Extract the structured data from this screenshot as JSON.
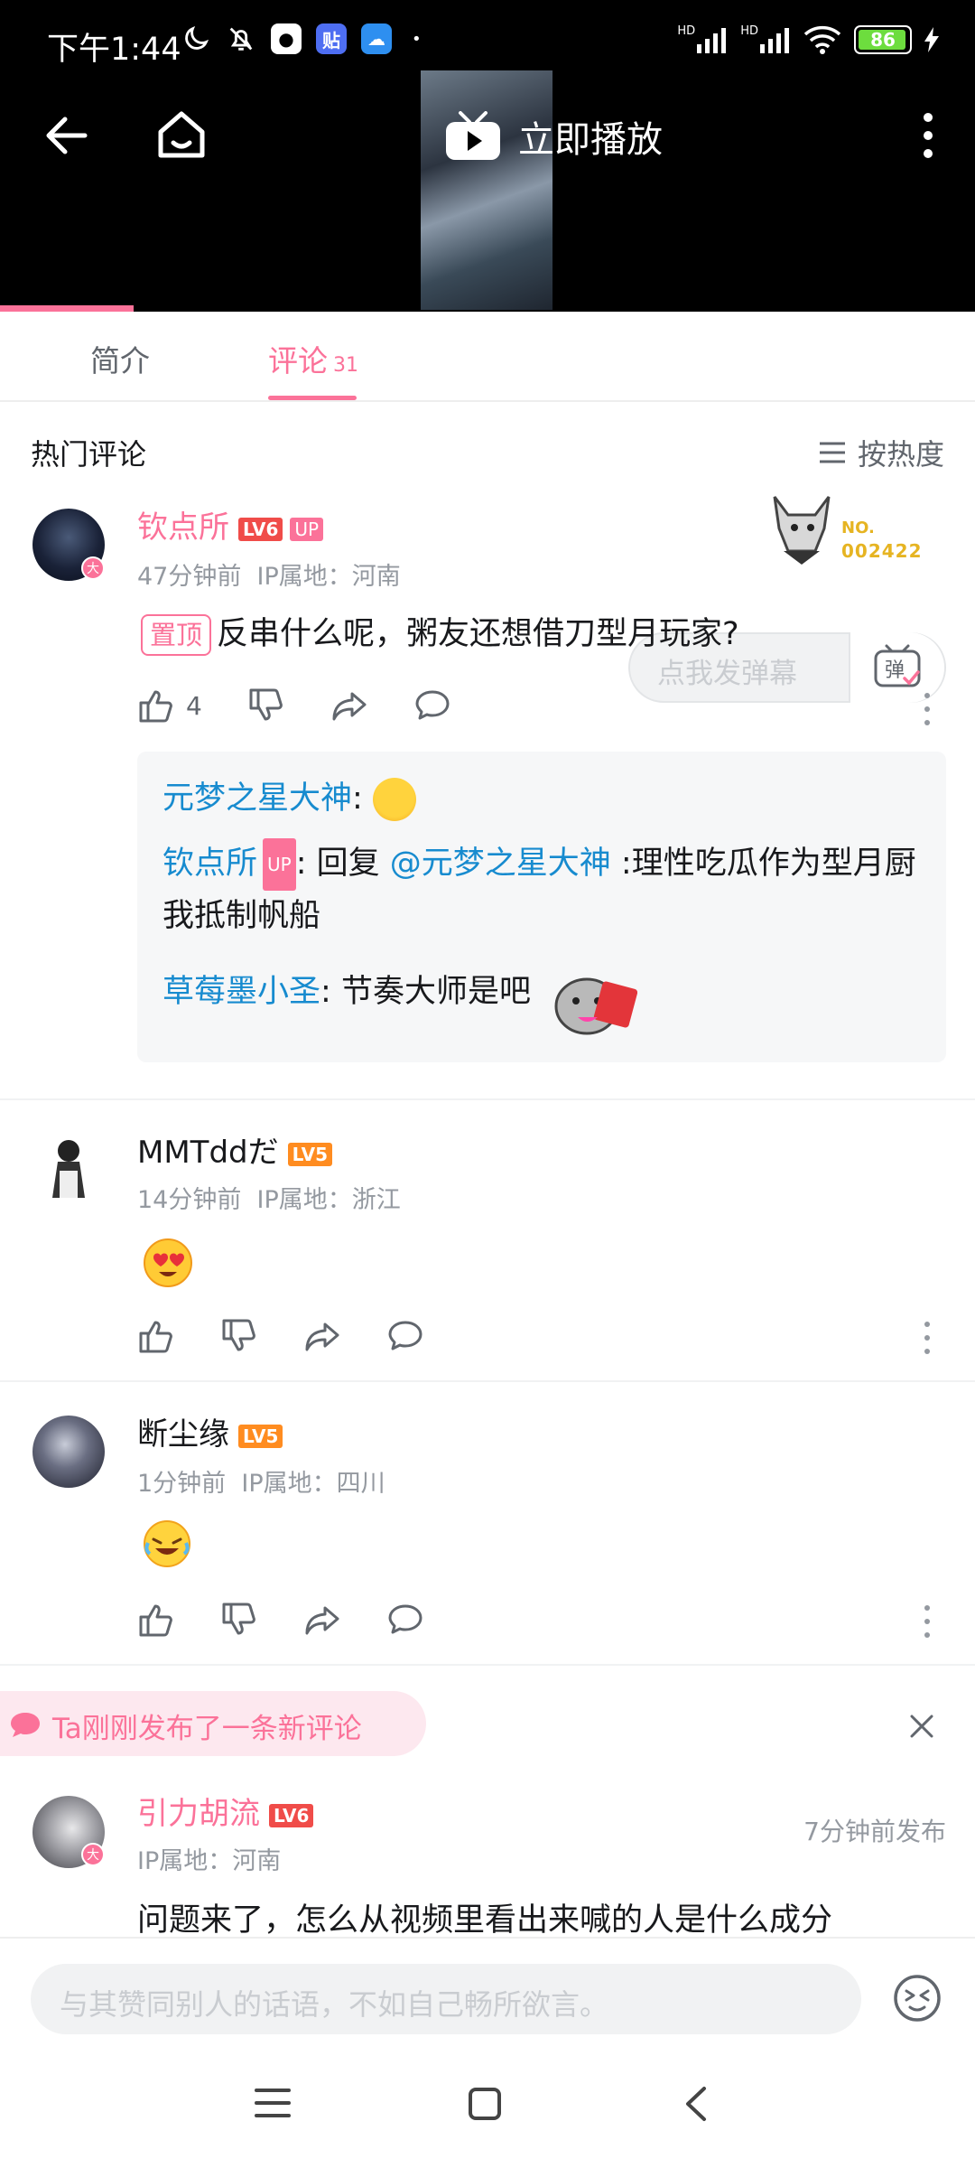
{
  "status_bar": {
    "time": "下午1:44",
    "battery": "86",
    "hd1": "HD",
    "hd2": "HD",
    "app_icon_label": "贴"
  },
  "video": {
    "play_label": "立即播放"
  },
  "tabs": {
    "intro": "简介",
    "comments": "评论",
    "comment_count": "31"
  },
  "danmaku": {
    "placeholder": "点我发弹幕",
    "button_label": "弹"
  },
  "comments_header": {
    "title": "热门评论",
    "sort_label": "按热度"
  },
  "comments": [
    {
      "user": "钦点所",
      "level": "LV6",
      "up_badge": "UP",
      "avatar_badge": "大",
      "time": "47分钟前",
      "ip": "IP属地：河南",
      "pinned_label": "置顶",
      "text": "反串什么呢，粥友还想借刀型月玩家?",
      "likes": "4",
      "fan_no_label": "NO.",
      "fan_no": "002422",
      "replies": [
        {
          "name": "元梦之星大神",
          "sep": ": ",
          "text": ""
        },
        {
          "name": "钦点所",
          "up": "UP",
          "sep": ": 回复 ",
          "mention": "@元梦之星大神",
          "text": " :理性吃瓜作为型月厨我抵制帆船"
        },
        {
          "name": "草莓墨小圣",
          "sep": ": ",
          "text": "节奏大师是吧"
        }
      ]
    },
    {
      "user": "MMTddだ",
      "level": "LV5",
      "time": "14分钟前",
      "ip": "IP属地：浙江"
    },
    {
      "user": "断尘缘",
      "level": "LV5",
      "time": "1分钟前",
      "ip": "IP属地：四川"
    }
  ],
  "new_comment_banner": {
    "text": "Ta刚刚发布了一条新评论"
  },
  "new_comment": {
    "user": "引力胡流",
    "level": "LV6",
    "avatar_badge": "大",
    "ip": "IP属地：河南",
    "posted": "7分钟前发布",
    "text": "问题来了，怎么从视频里看出来喊的人是什么成分"
  },
  "composer": {
    "placeholder": "与其赞同别人的话语，不如自己畅所欲言。"
  },
  "colors": {
    "accent": "#fb7299",
    "reply_name": "#178bcf",
    "level5": "#ff8c20",
    "level6": "#f04c49"
  }
}
